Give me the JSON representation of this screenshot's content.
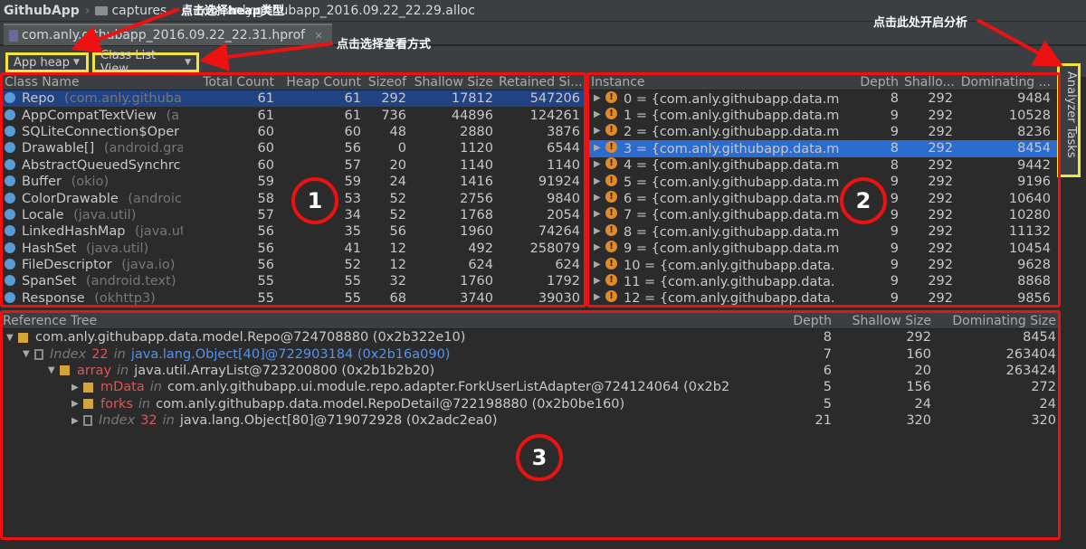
{
  "breadcrumb": {
    "app": "GithubApp",
    "folder": "captures",
    "file": "com.anly.githubapp_2016.09.22_22.29.alloc"
  },
  "tab": {
    "label": "com.anly.githubapp_2016.09.22_22.31.hprof",
    "close": "×"
  },
  "annotations": {
    "heap_type": "点击选择heap类型",
    "view_mode": "点击选择查看方式",
    "start_analysis": "点击此处开启分析",
    "circle1": "1",
    "circle2": "2",
    "circle3": "3"
  },
  "toolbar": {
    "heap_select": "App heap",
    "view_select": "Class List View"
  },
  "class_table": {
    "headers": [
      "Class Name",
      "Total Count",
      "Heap Count",
      "Sizeof",
      "Shallow Size",
      "Retained Si..."
    ],
    "rows": [
      {
        "name": "Repo",
        "pkg": "(com.anly.githuba",
        "total": "61",
        "heap": "61",
        "sizeof": "292",
        "shallow": "17812",
        "retained": "547206"
      },
      {
        "name": "AppCompatTextView",
        "pkg": "(a",
        "total": "61",
        "heap": "61",
        "sizeof": "736",
        "shallow": "44896",
        "retained": "124261"
      },
      {
        "name": "SQLiteConnection$Oper",
        "pkg": "",
        "total": "60",
        "heap": "60",
        "sizeof": "48",
        "shallow": "2880",
        "retained": "3876"
      },
      {
        "name": "Drawable[]",
        "pkg": "(android.gra",
        "total": "60",
        "heap": "56",
        "sizeof": "0",
        "shallow": "1120",
        "retained": "6544"
      },
      {
        "name": "AbstractQueuedSynchrc",
        "pkg": "",
        "total": "60",
        "heap": "57",
        "sizeof": "20",
        "shallow": "1140",
        "retained": "1140"
      },
      {
        "name": "Buffer",
        "pkg": "(okio)",
        "total": "59",
        "heap": "59",
        "sizeof": "24",
        "shallow": "1416",
        "retained": "91924"
      },
      {
        "name": "ColorDrawable",
        "pkg": "(androic",
        "total": "58",
        "heap": "53",
        "sizeof": "52",
        "shallow": "2756",
        "retained": "9840"
      },
      {
        "name": "Locale",
        "pkg": "(java.util)",
        "total": "57",
        "heap": "34",
        "sizeof": "52",
        "shallow": "1768",
        "retained": "2054"
      },
      {
        "name": "LinkedHashMap",
        "pkg": "(java.ut",
        "total": "56",
        "heap": "35",
        "sizeof": "56",
        "shallow": "1960",
        "retained": "74264"
      },
      {
        "name": "HashSet",
        "pkg": "(java.util)",
        "total": "56",
        "heap": "41",
        "sizeof": "12",
        "shallow": "492",
        "retained": "258079"
      },
      {
        "name": "FileDescriptor",
        "pkg": "(java.io)",
        "total": "56",
        "heap": "52",
        "sizeof": "12",
        "shallow": "624",
        "retained": "624"
      },
      {
        "name": "SpanSet",
        "pkg": "(android.text)",
        "total": "55",
        "heap": "55",
        "sizeof": "32",
        "shallow": "1760",
        "retained": "1792"
      },
      {
        "name": "Response",
        "pkg": "(okhttp3)",
        "total": "55",
        "heap": "55",
        "sizeof": "68",
        "shallow": "3740",
        "retained": "39030"
      }
    ]
  },
  "instance_table": {
    "headers": [
      "Instance",
      "Depth",
      "Shallo...",
      "Dominating ..."
    ],
    "rows": [
      {
        "label": "0 = {com.anly.githubapp.data.m",
        "depth": "8",
        "shallow": "292",
        "dom": "9484"
      },
      {
        "label": "1 = {com.anly.githubapp.data.m",
        "depth": "9",
        "shallow": "292",
        "dom": "10528"
      },
      {
        "label": "2 = {com.anly.githubapp.data.m",
        "depth": "9",
        "shallow": "292",
        "dom": "8236"
      },
      {
        "label": "3 = {com.anly.githubapp.data.m",
        "depth": "8",
        "shallow": "292",
        "dom": "8454"
      },
      {
        "label": "4 = {com.anly.githubapp.data.m",
        "depth": "8",
        "shallow": "292",
        "dom": "9442"
      },
      {
        "label": "5 = {com.anly.githubapp.data.m",
        "depth": "9",
        "shallow": "292",
        "dom": "9196"
      },
      {
        "label": "6 = {com.anly.githubapp.data.m",
        "depth": "9",
        "shallow": "292",
        "dom": "10640"
      },
      {
        "label": "7 = {com.anly.githubapp.data.m",
        "depth": "9",
        "shallow": "292",
        "dom": "10280"
      },
      {
        "label": "8 = {com.anly.githubapp.data.m",
        "depth": "9",
        "shallow": "292",
        "dom": "11132"
      },
      {
        "label": "9 = {com.anly.githubapp.data.m",
        "depth": "9",
        "shallow": "292",
        "dom": "10454"
      },
      {
        "label": "10 = {com.anly.githubapp.data.",
        "depth": "9",
        "shallow": "292",
        "dom": "9628"
      },
      {
        "label": "11 = {com.anly.githubapp.data.",
        "depth": "9",
        "shallow": "292",
        "dom": "8868"
      },
      {
        "label": "12 = {com.anly.githubapp.data.",
        "depth": "9",
        "shallow": "292",
        "dom": "9856"
      }
    ]
  },
  "sidebar": {
    "label": "Analyzer Tasks"
  },
  "reference_tree": {
    "headers": [
      "Reference Tree",
      "Depth",
      "Shallow Size",
      "Dominating Size"
    ],
    "rows": [
      {
        "prefix": "",
        "field": "",
        "in": "",
        "obj": "com.anly.githubapp.data.model.Repo@724708880 (0x2b322e10)",
        "depth": "8",
        "shallow": "292",
        "dom": "8454"
      },
      {
        "prefix": "Index",
        "field": "22",
        "in": "in",
        "obj": "java.lang.Object[40]@722903184 (0x2b16a090)",
        "depth": "7",
        "shallow": "160",
        "dom": "263404"
      },
      {
        "prefix": "",
        "field": "array",
        "in": "in",
        "obj": "java.util.ArrayList@723200800 (0x2b1b2b20)",
        "depth": "6",
        "shallow": "20",
        "dom": "263424"
      },
      {
        "prefix": "",
        "field": "mData",
        "in": "in",
        "obj": "com.anly.githubapp.ui.module.repo.adapter.ForkUserListAdapter@724124064 (0x2b2",
        "depth": "5",
        "shallow": "156",
        "dom": "272"
      },
      {
        "prefix": "",
        "field": "forks",
        "in": "in",
        "obj": "com.anly.githubapp.data.model.RepoDetail@722198880 (0x2b0be160)",
        "depth": "5",
        "shallow": "24",
        "dom": "24"
      },
      {
        "prefix": "Index",
        "field": "32",
        "in": "in",
        "obj": "java.lang.Object[80]@719072928 (0x2adc2ea0)",
        "depth": "21",
        "shallow": "320",
        "dom": "320"
      }
    ]
  }
}
